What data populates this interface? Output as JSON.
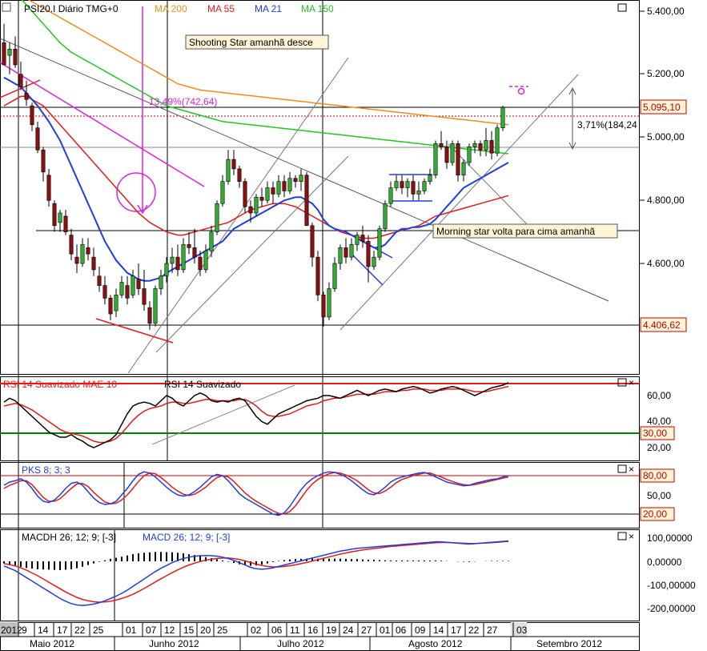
{
  "main_panel": {
    "instrument_label": "PSI20.I Diário TMG+0",
    "indicators": [
      {
        "label": "MA 200",
        "color": "#f08c1e"
      },
      {
        "label": "MA 55",
        "color": "#e41a1a"
      },
      {
        "label": "MA 21",
        "color": "#1f3ee0"
      },
      {
        "label": "MA 150",
        "color": "#20c820"
      }
    ],
    "annotations": {
      "shooting_star": "Shooting Star amanhã desce",
      "morning_star": "Morning star volta para cima amanhã",
      "percent_left": "13,49%(742,64)",
      "percent_right": "3,71%(184,24"
    },
    "price_tags": {
      "current": "5.095,10",
      "low": "4.406,62"
    },
    "y_ticks": [
      "5.400,00",
      "5.200,00",
      "5.000,00",
      "4.800,00",
      "4.600,00"
    ]
  },
  "rsi_panel": {
    "label_a": "RSI 14 Suavizado MAE 10",
    "label_b": "RSI 14 Suavizado",
    "y_ticks": [
      "60,00",
      "40,00",
      "20,00"
    ],
    "levels": [
      "30,00"
    ]
  },
  "pks_panel": {
    "label": "PKS 8; 3; 3",
    "y_ticks": [
      "50,00"
    ],
    "levels": [
      "80,00",
      "20,00"
    ]
  },
  "macd_panel": {
    "label_a": "MACDH 26; 12; 9; [-3]",
    "label_b": "MACD 26; 12; 9; [-3]",
    "y_ticks": [
      "100,00000",
      "0,00000",
      "-100,00000",
      "-200,00000"
    ]
  },
  "x_axis": {
    "days": [
      "2012",
      "9",
      "14",
      "17",
      "22",
      "25",
      "01",
      "07",
      "12",
      "15",
      "20",
      "25",
      "02",
      "06",
      "11",
      "16",
      "19",
      "24",
      "27",
      "01",
      "06",
      "09",
      "14",
      "17",
      "22",
      "27",
      "03"
    ],
    "months": [
      "Maio 2012",
      "Junho 2012",
      "Julho 2012",
      "Agosto 2012",
      "Setembro 2012"
    ]
  },
  "chart_data": {
    "type": "candlestick",
    "title": "PSI20.I Diário TMG+0",
    "y_range": [
      4250,
      5500
    ],
    "series_names": [
      "MA 200",
      "MA 55",
      "MA 21",
      "MA 150"
    ],
    "candles": [
      [
        5300,
        5360,
        5230,
        5230
      ],
      [
        5260,
        5300,
        5200,
        5280
      ],
      [
        5280,
        5320,
        5220,
        5230
      ],
      [
        5200,
        5240,
        5150,
        5160
      ],
      [
        5140,
        5180,
        5100,
        5120
      ],
      [
        5100,
        5110,
        5020,
        5040
      ],
      [
        5030,
        5050,
        4950,
        4960
      ],
      [
        4960,
        4970,
        4860,
        4890
      ],
      [
        4880,
        4900,
        4780,
        4800
      ],
      [
        4790,
        4800,
        4700,
        4720
      ],
      [
        4730,
        4770,
        4700,
        4760
      ],
      [
        4750,
        4770,
        4690,
        4700
      ],
      [
        4690,
        4710,
        4610,
        4630
      ],
      [
        4620,
        4660,
        4570,
        4600
      ],
      [
        4600,
        4680,
        4590,
        4660
      ],
      [
        4650,
        4680,
        4610,
        4630
      ],
      [
        4620,
        4650,
        4560,
        4580
      ],
      [
        4560,
        4590,
        4510,
        4530
      ],
      [
        4530,
        4560,
        4470,
        4490
      ],
      [
        4490,
        4500,
        4420,
        4440
      ],
      [
        4450,
        4520,
        4430,
        4500
      ],
      [
        4500,
        4560,
        4490,
        4540
      ],
      [
        4530,
        4560,
        4470,
        4490
      ],
      [
        4500,
        4580,
        4490,
        4560
      ],
      [
        4550,
        4600,
        4500,
        4520
      ],
      [
        4520,
        4580,
        4450,
        4470
      ],
      [
        4460,
        4480,
        4390,
        4410
      ],
      [
        4410,
        4530,
        4400,
        4520
      ],
      [
        4520,
        4580,
        4500,
        4560
      ],
      [
        4560,
        4620,
        4540,
        4600
      ],
      [
        4600,
        4650,
        4570,
        4620
      ],
      [
        4620,
        4660,
        4560,
        4580
      ],
      [
        4580,
        4680,
        4570,
        4660
      ],
      [
        4660,
        4700,
        4630,
        4650
      ],
      [
        4650,
        4710,
        4600,
        4620
      ],
      [
        4620,
        4640,
        4560,
        4580
      ],
      [
        4580,
        4660,
        4570,
        4640
      ],
      [
        4640,
        4720,
        4620,
        4700
      ],
      [
        4700,
        4800,
        4690,
        4790
      ],
      [
        4790,
        4880,
        4780,
        4860
      ],
      [
        4860,
        4960,
        4850,
        4930
      ],
      [
        4930,
        4960,
        4880,
        4900
      ],
      [
        4900,
        4910,
        4840,
        4860
      ],
      [
        4860,
        4870,
        4760,
        4780
      ],
      [
        4780,
        4800,
        4730,
        4760
      ],
      [
        4760,
        4820,
        4750,
        4810
      ],
      [
        4810,
        4840,
        4780,
        4800
      ],
      [
        4800,
        4860,
        4790,
        4840
      ],
      [
        4840,
        4860,
        4790,
        4820
      ],
      [
        4820,
        4880,
        4810,
        4860
      ],
      [
        4860,
        4880,
        4810,
        4830
      ],
      [
        4830,
        4890,
        4820,
        4870
      ],
      [
        4870,
        4880,
        4840,
        4860
      ],
      [
        4860,
        4900,
        4830,
        4880
      ],
      [
        4880,
        4890,
        4780,
        4720
      ],
      [
        4720,
        4730,
        4590,
        4620
      ],
      [
        4620,
        4640,
        4480,
        4500
      ],
      [
        4500,
        4510,
        4400,
        4430
      ],
      [
        4430,
        4540,
        4420,
        4520
      ],
      [
        4520,
        4620,
        4510,
        4600
      ],
      [
        4600,
        4660,
        4580,
        4650
      ],
      [
        4650,
        4680,
        4600,
        4620
      ],
      [
        4620,
        4680,
        4610,
        4660
      ],
      [
        4660,
        4700,
        4640,
        4690
      ],
      [
        4690,
        4720,
        4650,
        4670
      ],
      [
        4670,
        4690,
        4540,
        4590
      ],
      [
        4590,
        4640,
        4580,
        4620
      ],
      [
        4620,
        4720,
        4610,
        4710
      ],
      [
        4710,
        4800,
        4700,
        4790
      ],
      [
        4790,
        4860,
        4780,
        4840
      ],
      [
        4840,
        4880,
        4830,
        4860
      ],
      [
        4860,
        4880,
        4820,
        4840
      ],
      [
        4840,
        4870,
        4810,
        4860
      ],
      [
        4860,
        4880,
        4800,
        4820
      ],
      [
        4820,
        4860,
        4800,
        4830
      ],
      [
        4830,
        4870,
        4820,
        4860
      ],
      [
        4860,
        4900,
        4850,
        4880
      ],
      [
        4880,
        4990,
        4870,
        4980
      ],
      [
        4980,
        5020,
        4960,
        4970
      ],
      [
        4970,
        4990,
        4900,
        4920
      ],
      [
        4920,
        4990,
        4910,
        4980
      ],
      [
        4980,
        4990,
        4860,
        4880
      ],
      [
        4880,
        4930,
        4860,
        4920
      ],
      [
        4920,
        4980,
        4910,
        4970
      ],
      [
        4970,
        4990,
        4950,
        4980
      ],
      [
        4980,
        4990,
        4940,
        4960
      ],
      [
        4960,
        5030,
        4940,
        4990
      ],
      [
        4990,
        5020,
        4930,
        4950
      ],
      [
        4950,
        5040,
        4940,
        5030
      ],
      [
        5030,
        5100,
        5020,
        5095
      ]
    ],
    "ma21": [
      5190,
      5180,
      5170,
      5160,
      5140,
      5120,
      5100,
      5075,
      5050,
      5020,
      4990,
      4950,
      4910,
      4870,
      4830,
      4790,
      4750,
      4710,
      4670,
      4640,
      4610,
      4590,
      4570,
      4560,
      4550,
      4545,
      4545,
      4550,
      4555,
      4570,
      4580,
      4590,
      4600,
      4610,
      4620,
      4630,
      4640,
      4650,
      4660,
      4670,
      4690,
      4710,
      4720,
      4730,
      4740,
      4750,
      4760,
      4770,
      4780,
      4790,
      4800,
      4805,
      4810,
      4810,
      4800,
      4790,
      4770,
      4740,
      4720,
      4710,
      4705,
      4700,
      4690,
      4680,
      4670,
      4660,
      4650,
      4650,
      4660,
      4680,
      4700,
      4710,
      4710,
      4715,
      4715,
      4720,
      4725,
      4740,
      4760,
      4780,
      4800,
      4820,
      4840,
      4850,
      4860,
      4870,
      4880,
      4890,
      4900,
      4910,
      4920
    ],
    "ma55": [
      5100,
      5110,
      5120,
      5130,
      5130,
      5120,
      5110,
      5100,
      5080,
      5060,
      5040,
      5020,
      5000,
      4980,
      4960,
      4940,
      4920,
      4900,
      4880,
      4860,
      4840,
      4820,
      4800,
      4780,
      4760,
      4745,
      4730,
      4720,
      4710,
      4700,
      4695,
      4690,
      4690,
      4695,
      4700,
      4705,
      4710,
      4715,
      4720,
      4725,
      4730,
      4740,
      4750,
      4760,
      4770,
      4775,
      4780,
      4785,
      4790,
      4790,
      4790,
      4785,
      4780,
      4770,
      4760,
      4750,
      4740,
      4730,
      4720,
      4710,
      4700,
      4695,
      4690,
      4685,
      4680,
      4680,
      4680,
      4685,
      4690,
      4695,
      4700,
      4705,
      4710,
      4715,
      4720,
      4730,
      4740,
      4750,
      4755,
      4760,
      4765,
      4770,
      4775,
      4780,
      4785,
      4790,
      4795,
      4800,
      4805,
      4810,
      4815
    ],
    "ma200": [
      5480,
      5470,
      5460,
      5450,
      5440,
      5430,
      5420,
      5410,
      5400,
      5390,
      5380,
      5370,
      5360,
      5350,
      5340,
      5330,
      5320,
      5310,
      5300,
      5290,
      5280,
      5270,
      5260,
      5250,
      5240,
      5230,
      5220,
      5210,
      5200,
      5190,
      5180,
      5170,
      5165,
      5160,
      5155,
      5150,
      5148,
      5146,
      5144,
      5142,
      5140,
      5138,
      5136,
      5134,
      5132,
      5130,
      5128,
      5126,
      5124,
      5122,
      5120,
      5118,
      5116,
      5114,
      5112,
      5110,
      5108,
      5106,
      5104,
      5102,
      5100,
      5098,
      5096,
      5094,
      5092,
      5090,
      5088,
      5086,
      5084,
      5082,
      5080,
      5078,
      5076,
      5074,
      5072,
      5070,
      5068,
      5066,
      5064,
      5062,
      5060,
      5058,
      5056,
      5054,
      5052,
      5050,
      5048,
      5046,
      5044,
      5042,
      5040
    ],
    "ma150": [
      5500,
      5480,
      5460,
      5440,
      5420,
      5400,
      5380,
      5360,
      5340,
      5320,
      5300,
      5285,
      5270,
      5260,
      5250,
      5240,
      5230,
      5220,
      5210,
      5200,
      5190,
      5180,
      5170,
      5160,
      5150,
      5140,
      5130,
      5120,
      5110,
      5100,
      5095,
      5090,
      5085,
      5080,
      5075,
      5070,
      5065,
      5060,
      5055,
      5050,
      5048,
      5046,
      5044,
      5042,
      5040,
      5038,
      5036,
      5034,
      5032,
      5030,
      5028,
      5026,
      5024,
      5022,
      5020,
      5018,
      5016,
      5014,
      5012,
      5010,
      5008,
      5006,
      5004,
      5002,
      5000,
      4998,
      4996,
      4994,
      4992,
      4990,
      4988,
      4986,
      4984,
      4982,
      4980,
      4978,
      4976,
      4974,
      4972,
      4970,
      4968,
      4966,
      4964,
      4962,
      4960,
      4958,
      4956,
      4954,
      4952,
      4950,
      4948
    ],
    "rsi": [
      55,
      58,
      56,
      52,
      48,
      44,
      40,
      36,
      32,
      30,
      28,
      28,
      30,
      27,
      25,
      22,
      20,
      22,
      24,
      26,
      30,
      38,
      46,
      52,
      54,
      55,
      54,
      52,
      56,
      60,
      58,
      54,
      52,
      56,
      60,
      62,
      60,
      56,
      55,
      56,
      55,
      57,
      58,
      56,
      50,
      44,
      40,
      38,
      42,
      46,
      48,
      50,
      52,
      54,
      56,
      57,
      58,
      60,
      60,
      59,
      58,
      60,
      62,
      64,
      62,
      60,
      62,
      64,
      65,
      64,
      63,
      65,
      66,
      67,
      66,
      64,
      62,
      63,
      65,
      66,
      67,
      66,
      64,
      62,
      60,
      62,
      64,
      66,
      67,
      68,
      70
    ],
    "rsi_ma": [
      52,
      53,
      54,
      53,
      51,
      49,
      46,
      43,
      40,
      37,
      34,
      32,
      31,
      30,
      29,
      27,
      25,
      24,
      24,
      25,
      27,
      31,
      36,
      41,
      45,
      48,
      50,
      51,
      52,
      54,
      55,
      55,
      54,
      54,
      55,
      56,
      57,
      57,
      56,
      56,
      56,
      56,
      57,
      57,
      55,
      52,
      48,
      45,
      44,
      44,
      45,
      46,
      48,
      50,
      52,
      53,
      54,
      56,
      57,
      58,
      58,
      59,
      60,
      61,
      61,
      61,
      61,
      62,
      63,
      63,
      63,
      64,
      64,
      65,
      65,
      65,
      64,
      64,
      64,
      65,
      65,
      65,
      65,
      64,
      63,
      63,
      63,
      64,
      65,
      66,
      67
    ],
    "pks_k": [
      65,
      70,
      72,
      75,
      70,
      60,
      48,
      40,
      38,
      42,
      50,
      60,
      68,
      70,
      65,
      55,
      45,
      38,
      35,
      36,
      40,
      50,
      60,
      72,
      82,
      86,
      84,
      78,
      70,
      62,
      55,
      50,
      48,
      50,
      55,
      62,
      70,
      78,
      82,
      80,
      72,
      62,
      52,
      45,
      40,
      35,
      30,
      25,
      20,
      18,
      22,
      32,
      45,
      58,
      68,
      75,
      80,
      84,
      86,
      85,
      82,
      78,
      72,
      65,
      58,
      52,
      50,
      55,
      62,
      70,
      75,
      78,
      80,
      82,
      84,
      85,
      82,
      78,
      74,
      70,
      68,
      66,
      64,
      65,
      68,
      70,
      72,
      74,
      75,
      78,
      80
    ],
    "pks_d": [
      60,
      65,
      68,
      72,
      72,
      66,
      56,
      46,
      40,
      40,
      44,
      52,
      60,
      67,
      68,
      63,
      54,
      46,
      39,
      36,
      37,
      42,
      50,
      60,
      71,
      80,
      84,
      83,
      77,
      70,
      62,
      56,
      51,
      49,
      51,
      56,
      62,
      70,
      77,
      80,
      78,
      71,
      62,
      53,
      46,
      40,
      35,
      30,
      25,
      21,
      20,
      24,
      33,
      45,
      57,
      67,
      74,
      79,
      83,
      85,
      84,
      81,
      77,
      72,
      65,
      58,
      53,
      52,
      56,
      62,
      69,
      74,
      77,
      80,
      82,
      84,
      84,
      81,
      78,
      74,
      71,
      68,
      66,
      65,
      66,
      68,
      70,
      72,
      74,
      76,
      78
    ],
    "macd_line": [
      -20,
      -30,
      -40,
      -55,
      -70,
      -85,
      -100,
      -115,
      -130,
      -145,
      -160,
      -172,
      -182,
      -188,
      -190,
      -188,
      -184,
      -178,
      -170,
      -160,
      -150,
      -138,
      -124,
      -108,
      -92,
      -76,
      -60,
      -44,
      -30,
      -18,
      -6,
      4,
      12,
      18,
      22,
      24,
      25,
      24,
      22,
      18,
      12,
      4,
      -6,
      -16,
      -26,
      -32,
      -34,
      -32,
      -28,
      -22,
      -16,
      -10,
      -4,
      2,
      8,
      14,
      20,
      26,
      32,
      38,
      44,
      48,
      52,
      56,
      58,
      60,
      62,
      64,
      66,
      68,
      70,
      72,
      74,
      76,
      78,
      80,
      82,
      84,
      84,
      82,
      80,
      78,
      76,
      74,
      76,
      78,
      80,
      82,
      84,
      86,
      88
    ],
    "macd_signal": [
      -10,
      -14,
      -20,
      -28,
      -38,
      -50,
      -62,
      -76,
      -90,
      -104,
      -118,
      -132,
      -144,
      -155,
      -164,
      -170,
      -174,
      -176,
      -175,
      -172,
      -167,
      -160,
      -152,
      -142,
      -130,
      -117,
      -103,
      -89,
      -75,
      -62,
      -49,
      -37,
      -26,
      -16,
      -8,
      -1,
      5,
      9,
      12,
      14,
      14,
      12,
      8,
      2,
      -5,
      -12,
      -18,
      -22,
      -24,
      -24,
      -22,
      -19,
      -15,
      -10,
      -5,
      1,
      7,
      13,
      19,
      25,
      31,
      36,
      41,
      45,
      49,
      52,
      55,
      58,
      61,
      64,
      66,
      68,
      70,
      72,
      74,
      76,
      78,
      80,
      81,
      81,
      80,
      79,
      78,
      77,
      77,
      78,
      79,
      80,
      82,
      84,
      86
    ]
  }
}
